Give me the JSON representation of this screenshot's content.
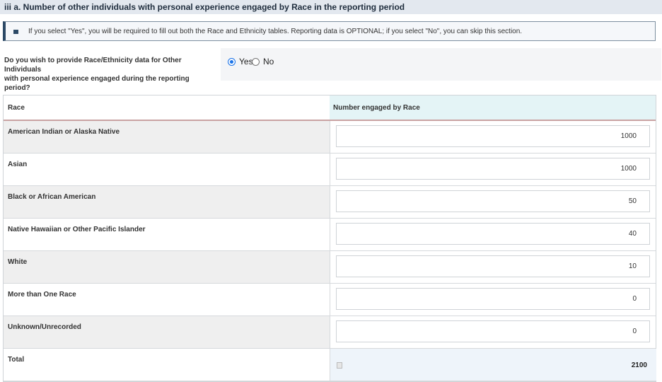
{
  "section": {
    "title": "iii a. Number of other individuals with personal experience engaged by Race in the reporting period"
  },
  "info": {
    "icon": "info-marker-icon",
    "text": "If you select \"Yes\", you will be required to fill out both the Race and Ethnicity tables. Reporting data is OPTIONAL; if you select \"No\", you can skip this section."
  },
  "question": {
    "line1": "Do you wish to provide Race/Ethnicity data for Other Individuals",
    "line2": "with personal experience engaged during the reporting period?",
    "options": [
      {
        "label": "Yes",
        "selected": true
      },
      {
        "label": "No",
        "selected": false
      }
    ]
  },
  "table": {
    "headers": [
      "Race",
      "Number engaged by Race"
    ],
    "rows": [
      {
        "label": "American Indian or Alaska Native",
        "value": "1000"
      },
      {
        "label": "Asian",
        "value": "1000"
      },
      {
        "label": "Black or African American",
        "value": "50"
      },
      {
        "label": "Native Hawaiian or Other Pacific Islander",
        "value": "40"
      },
      {
        "label": "White",
        "value": "10"
      },
      {
        "label": "More than One Race",
        "value": "0"
      },
      {
        "label": "Unknown/Unrecorded",
        "value": "0"
      }
    ],
    "total": {
      "label": "Total",
      "value": "2100",
      "icon": "calculator-icon"
    }
  },
  "colors": {
    "header_bg": "#e3e8ef",
    "accent": "#2c4966",
    "table_header_bg": "#e4f4f6",
    "radio_selected": "#1a73e8"
  }
}
